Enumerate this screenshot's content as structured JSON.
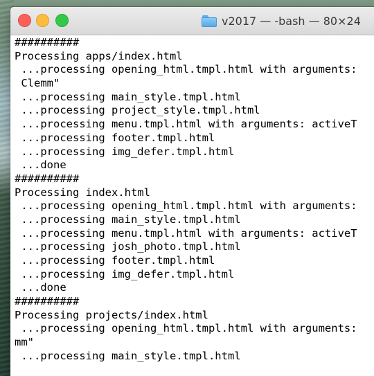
{
  "window": {
    "title": "v2017 — -bash — 80×24",
    "folder_icon": "folder-icon"
  },
  "terminal": {
    "lines": [
      "##########",
      "Processing apps/index.html",
      " ...processing opening_html.tmpl.html with arguments: ",
      " Clemm\"",
      " ...processing main_style.tmpl.html",
      " ...processing project_style.tmpl.html",
      " ...processing menu.tmpl.html with arguments: activeT",
      " ...processing footer.tmpl.html",
      " ...processing img_defer.tmpl.html",
      " ...done",
      "##########",
      "Processing index.html",
      " ...processing opening_html.tmpl.html with arguments: ",
      " ...processing main_style.tmpl.html",
      " ...processing menu.tmpl.html with arguments: activeT",
      " ...processing josh_photo.tmpl.html",
      " ...processing footer.tmpl.html",
      " ...processing img_defer.tmpl.html",
      " ...done",
      "##########",
      "Processing projects/index.html",
      " ...processing opening_html.tmpl.html with arguments: ",
      "mm\"",
      " ...processing main_style.tmpl.html"
    ]
  },
  "colors": {
    "close": "#fc605b",
    "minimize": "#fdbc40",
    "zoom": "#34c84a",
    "terminal_bg": "#ffffff",
    "terminal_text": "#000000"
  }
}
